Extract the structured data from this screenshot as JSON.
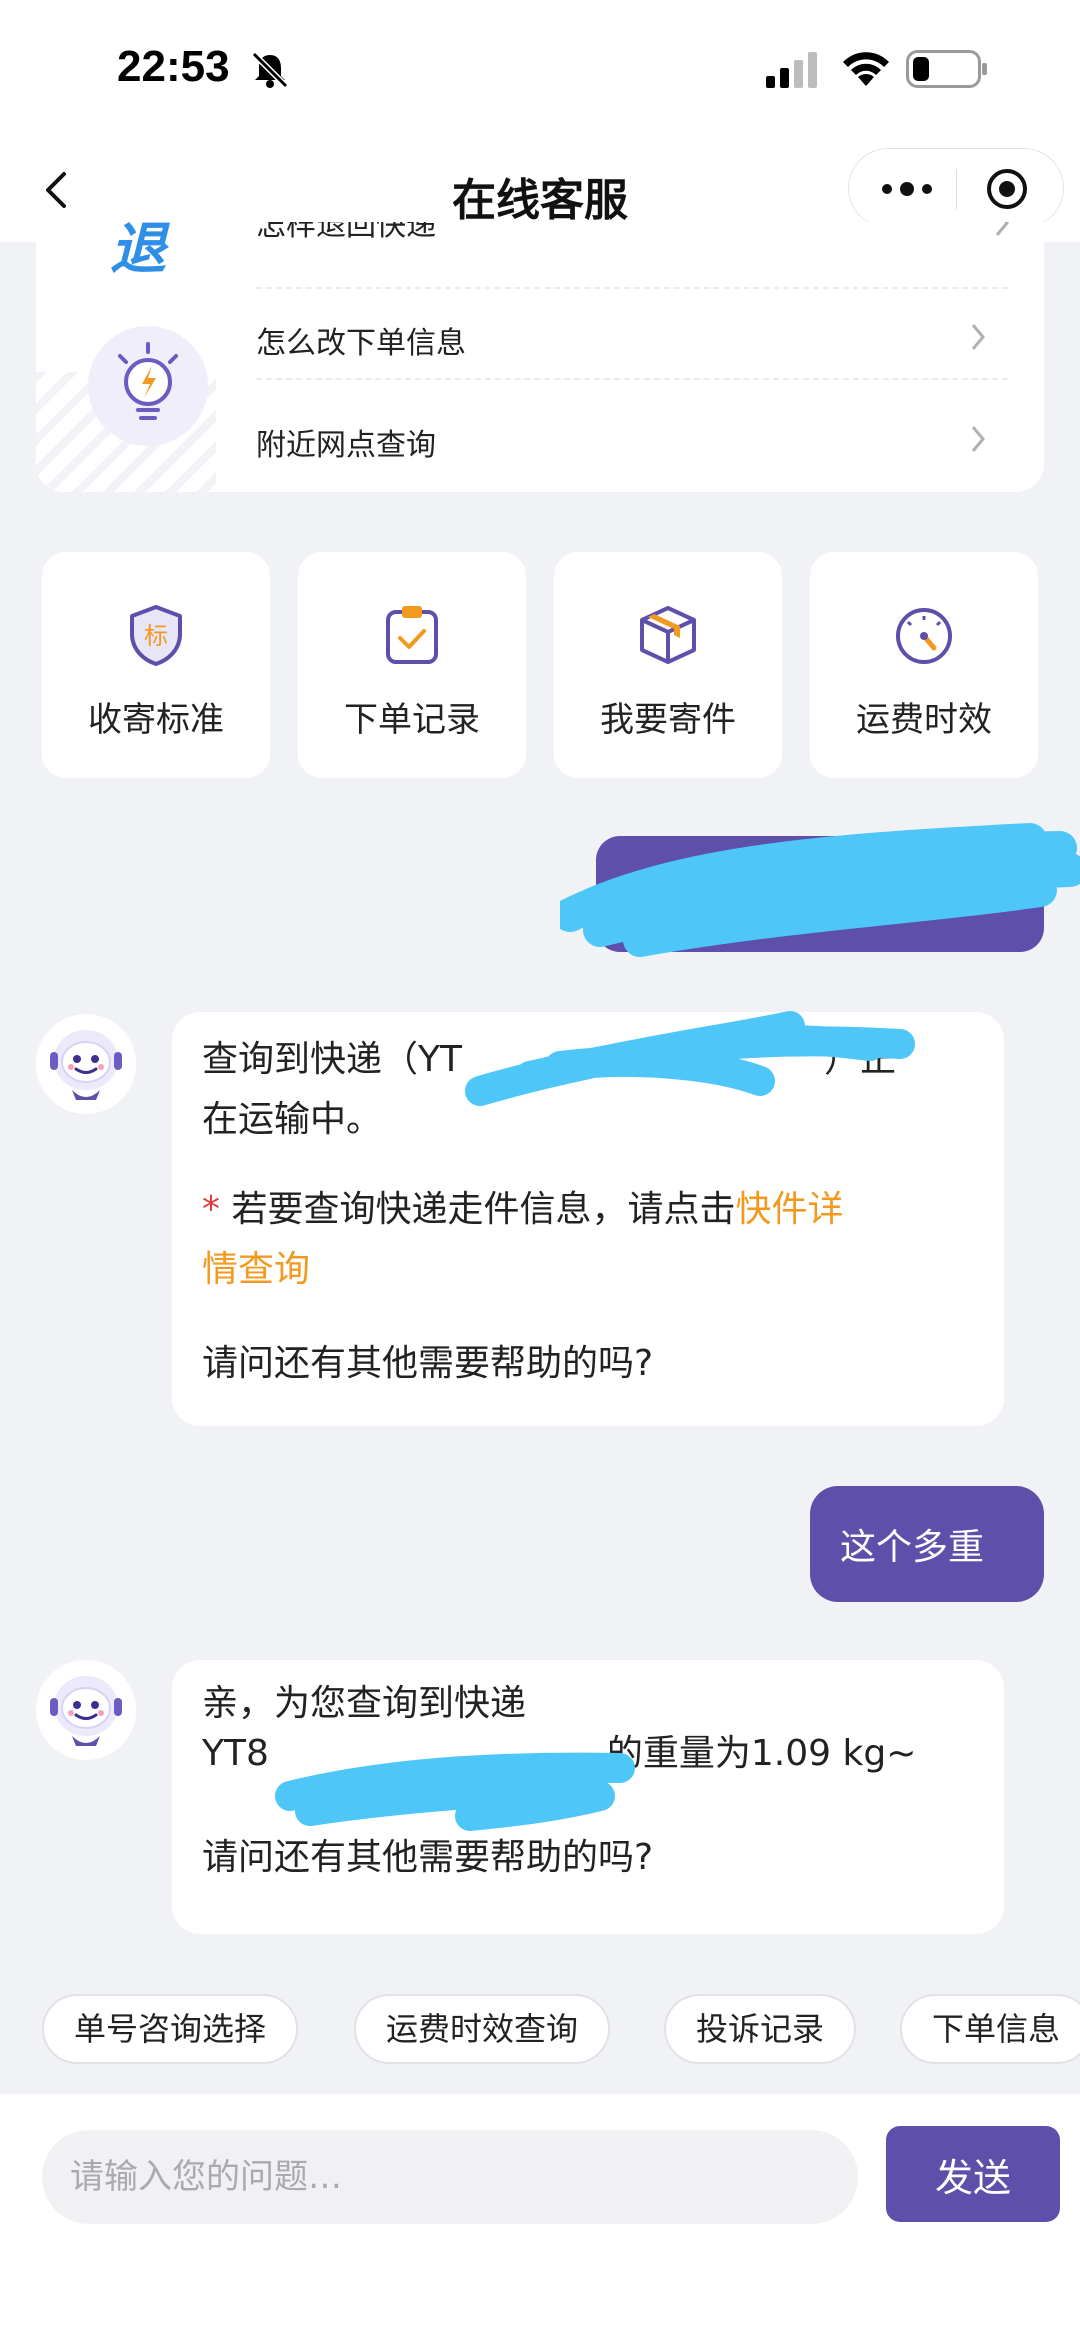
{
  "status_bar": {
    "time": "22:53"
  },
  "nav": {
    "title": "在线客服"
  },
  "faq": {
    "partial_item": "怎样退回快递",
    "items": [
      {
        "label": "怎么改下单信息"
      },
      {
        "label": "附近网点查询"
      }
    ]
  },
  "tiles": [
    {
      "label": "收寄标准",
      "icon": "shield-badge-icon",
      "badge": "标"
    },
    {
      "label": "下单记录",
      "icon": "clipboard-check-icon"
    },
    {
      "label": "我要寄件",
      "icon": "package-box-icon"
    },
    {
      "label": "运费时效",
      "icon": "speedometer-icon"
    }
  ],
  "chat": {
    "bot_message_1": {
      "line1_prefix": "查询到快递（YT",
      "line1_suffix": "）正",
      "line2": "在运输中。",
      "star": "*",
      "hint_prefix": " 若要查询快递走件信息，请点击",
      "hint_link_1": "快件详",
      "hint_link_2": "情查询",
      "closing": "请问还有其他需要帮助的吗?"
    },
    "user_message_2": "这个多重",
    "bot_message_2": {
      "line1": "亲，为您查询到快递",
      "line2_prefix": "YT8",
      "line2_suffix": "的重量为1.09 kg~",
      "closing": "请问还有其他需要帮助的吗?"
    }
  },
  "chips": [
    "单号咨询选择",
    "运费时效查询",
    "投诉记录",
    "下单信息"
  ],
  "input": {
    "placeholder": "请输入您的问题…",
    "send_label": "发送"
  },
  "colors": {
    "accent": "#5e4fab",
    "link_orange": "#f29a1f",
    "redaction_blue": "#4ec6f8",
    "background": "#f1f2f6"
  }
}
